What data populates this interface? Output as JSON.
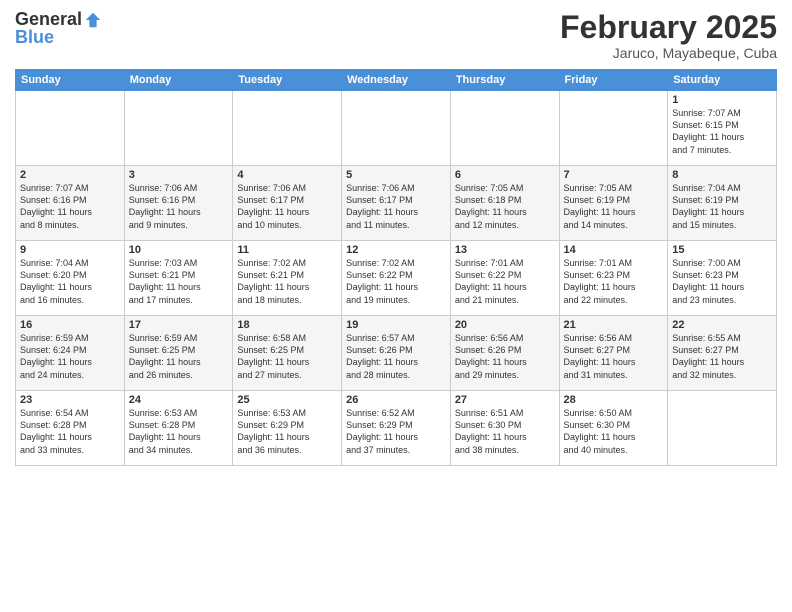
{
  "logo": {
    "general": "General",
    "blue": "Blue"
  },
  "header": {
    "month": "February 2025",
    "location": "Jaruco, Mayabeque, Cuba"
  },
  "days_of_week": [
    "Sunday",
    "Monday",
    "Tuesday",
    "Wednesday",
    "Thursday",
    "Friday",
    "Saturday"
  ],
  "weeks": [
    [
      {
        "day": "",
        "info": ""
      },
      {
        "day": "",
        "info": ""
      },
      {
        "day": "",
        "info": ""
      },
      {
        "day": "",
        "info": ""
      },
      {
        "day": "",
        "info": ""
      },
      {
        "day": "",
        "info": ""
      },
      {
        "day": "1",
        "info": "Sunrise: 7:07 AM\nSunset: 6:15 PM\nDaylight: 11 hours\nand 7 minutes."
      }
    ],
    [
      {
        "day": "2",
        "info": "Sunrise: 7:07 AM\nSunset: 6:16 PM\nDaylight: 11 hours\nand 8 minutes."
      },
      {
        "day": "3",
        "info": "Sunrise: 7:06 AM\nSunset: 6:16 PM\nDaylight: 11 hours\nand 9 minutes."
      },
      {
        "day": "4",
        "info": "Sunrise: 7:06 AM\nSunset: 6:17 PM\nDaylight: 11 hours\nand 10 minutes."
      },
      {
        "day": "5",
        "info": "Sunrise: 7:06 AM\nSunset: 6:17 PM\nDaylight: 11 hours\nand 11 minutes."
      },
      {
        "day": "6",
        "info": "Sunrise: 7:05 AM\nSunset: 6:18 PM\nDaylight: 11 hours\nand 12 minutes."
      },
      {
        "day": "7",
        "info": "Sunrise: 7:05 AM\nSunset: 6:19 PM\nDaylight: 11 hours\nand 14 minutes."
      },
      {
        "day": "8",
        "info": "Sunrise: 7:04 AM\nSunset: 6:19 PM\nDaylight: 11 hours\nand 15 minutes."
      }
    ],
    [
      {
        "day": "9",
        "info": "Sunrise: 7:04 AM\nSunset: 6:20 PM\nDaylight: 11 hours\nand 16 minutes."
      },
      {
        "day": "10",
        "info": "Sunrise: 7:03 AM\nSunset: 6:21 PM\nDaylight: 11 hours\nand 17 minutes."
      },
      {
        "day": "11",
        "info": "Sunrise: 7:02 AM\nSunset: 6:21 PM\nDaylight: 11 hours\nand 18 minutes."
      },
      {
        "day": "12",
        "info": "Sunrise: 7:02 AM\nSunset: 6:22 PM\nDaylight: 11 hours\nand 19 minutes."
      },
      {
        "day": "13",
        "info": "Sunrise: 7:01 AM\nSunset: 6:22 PM\nDaylight: 11 hours\nand 21 minutes."
      },
      {
        "day": "14",
        "info": "Sunrise: 7:01 AM\nSunset: 6:23 PM\nDaylight: 11 hours\nand 22 minutes."
      },
      {
        "day": "15",
        "info": "Sunrise: 7:00 AM\nSunset: 6:23 PM\nDaylight: 11 hours\nand 23 minutes."
      }
    ],
    [
      {
        "day": "16",
        "info": "Sunrise: 6:59 AM\nSunset: 6:24 PM\nDaylight: 11 hours\nand 24 minutes."
      },
      {
        "day": "17",
        "info": "Sunrise: 6:59 AM\nSunset: 6:25 PM\nDaylight: 11 hours\nand 26 minutes."
      },
      {
        "day": "18",
        "info": "Sunrise: 6:58 AM\nSunset: 6:25 PM\nDaylight: 11 hours\nand 27 minutes."
      },
      {
        "day": "19",
        "info": "Sunrise: 6:57 AM\nSunset: 6:26 PM\nDaylight: 11 hours\nand 28 minutes."
      },
      {
        "day": "20",
        "info": "Sunrise: 6:56 AM\nSunset: 6:26 PM\nDaylight: 11 hours\nand 29 minutes."
      },
      {
        "day": "21",
        "info": "Sunrise: 6:56 AM\nSunset: 6:27 PM\nDaylight: 11 hours\nand 31 minutes."
      },
      {
        "day": "22",
        "info": "Sunrise: 6:55 AM\nSunset: 6:27 PM\nDaylight: 11 hours\nand 32 minutes."
      }
    ],
    [
      {
        "day": "23",
        "info": "Sunrise: 6:54 AM\nSunset: 6:28 PM\nDaylight: 11 hours\nand 33 minutes."
      },
      {
        "day": "24",
        "info": "Sunrise: 6:53 AM\nSunset: 6:28 PM\nDaylight: 11 hours\nand 34 minutes."
      },
      {
        "day": "25",
        "info": "Sunrise: 6:53 AM\nSunset: 6:29 PM\nDaylight: 11 hours\nand 36 minutes."
      },
      {
        "day": "26",
        "info": "Sunrise: 6:52 AM\nSunset: 6:29 PM\nDaylight: 11 hours\nand 37 minutes."
      },
      {
        "day": "27",
        "info": "Sunrise: 6:51 AM\nSunset: 6:30 PM\nDaylight: 11 hours\nand 38 minutes."
      },
      {
        "day": "28",
        "info": "Sunrise: 6:50 AM\nSunset: 6:30 PM\nDaylight: 11 hours\nand 40 minutes."
      },
      {
        "day": "",
        "info": ""
      }
    ]
  ]
}
